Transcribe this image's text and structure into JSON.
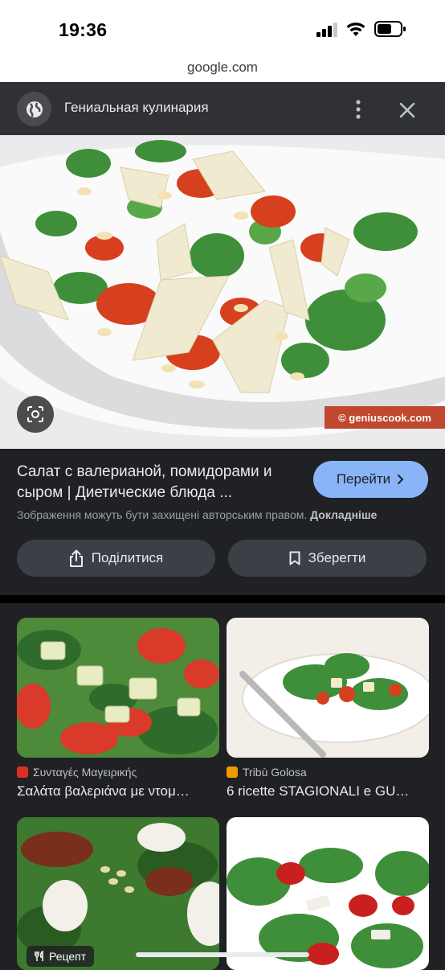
{
  "status_bar": {
    "time": "19:36",
    "icons": [
      "cellular-signal-icon",
      "wifi-icon",
      "battery-icon"
    ]
  },
  "url_bar": {
    "domain": "google.com"
  },
  "header": {
    "site_icon": "globe-icon",
    "site_name": "Гениальная кулинария",
    "more_icon": "more-vert-icon",
    "close_icon": "close-icon"
  },
  "main_image": {
    "lens_icon": "google-lens-icon",
    "watermark": "© geniuscook.com"
  },
  "result": {
    "title": "Салат с валерианой, помидорами и сыром | Диетические блюда ...",
    "visit_label": "Перейти",
    "copyright_text": "Зображення можуть бути захищені авторським правом.",
    "copyright_link": "Докладніше",
    "share_label": "Поділитися",
    "save_label": "Зберегти"
  },
  "related": [
    {
      "source": "Συνταγές Μαγειρικής",
      "caption": "Σαλάτα βαλεριάνα με ντομ…",
      "favicon_color": "#d93025"
    },
    {
      "source": "Tribù Golosa",
      "caption": "6 ricette STAGIONALI e GU…",
      "favicon_color": "#f29900"
    },
    {
      "badge": "Рецепт"
    },
    {}
  ],
  "colors": {
    "background": "#202124",
    "header": "#303134",
    "accent_button": "#8ab4f8",
    "secondary_button": "#3c4046",
    "watermark": "#c0482e"
  }
}
